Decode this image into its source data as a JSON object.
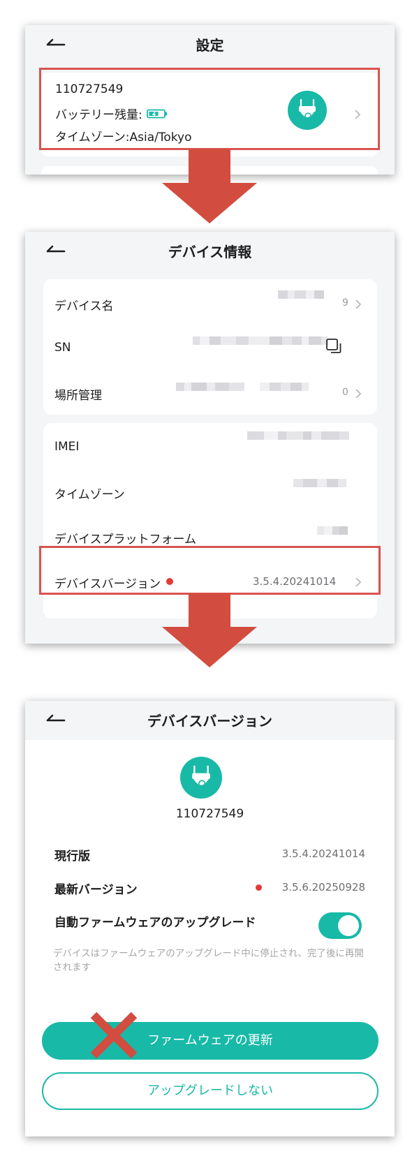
{
  "panel1": {
    "title": "設定",
    "device_id": "110727549",
    "battery_label": "バッテリー残量:",
    "timezone_line": "タイムゾーン:Asia/Tokyo"
  },
  "panel2": {
    "title": "デバイス情報",
    "group1": {
      "device_name_label": "デバイス名",
      "device_name_value_tail": "9",
      "sn_label": "SN",
      "location_label": "場所管理",
      "location_value_tail": "0"
    },
    "group2": {
      "imei_label": "IMEI",
      "timezone_label": "タイムゾーン",
      "platform_label": "デバイスプラットフォーム",
      "version_label": "デバイスバージョン",
      "version_value": "3.5.4.20241014"
    }
  },
  "panel3": {
    "title": "デバイスバージョン",
    "device_id": "110727549",
    "current_label": "現行版",
    "current_value": "3.5.4.20241014",
    "latest_label": "最新バージョン",
    "latest_value": "3.5.6.20250928",
    "auto_upgrade_label": "自動ファームウェアのアップグレード",
    "auto_upgrade_on": true,
    "note": "デバイスはファームウェアのアップグレード中に停止され、完了後に再開されます",
    "update_button": "ファームウェアの更新",
    "skip_button": "アップグレードしない"
  },
  "colors": {
    "accent": "#18b9a7",
    "highlight": "#d9534f",
    "arrow": "#d24c3f",
    "new_dot": "#e53935"
  },
  "icons": {
    "back": "back-arrow-icon",
    "chevron": "chevron-right-icon",
    "camera": "camera-icon",
    "battery": "battery-charging-icon",
    "copy": "copy-icon",
    "disabled": "x-cross-icon"
  }
}
